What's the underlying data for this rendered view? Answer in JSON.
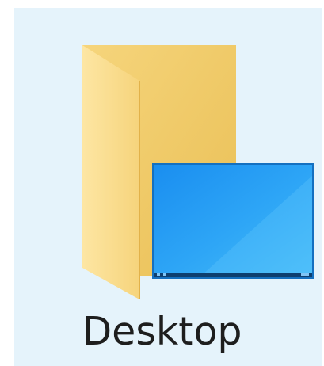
{
  "item": {
    "label": "Desktop",
    "icon": "desktop-folder-icon",
    "state": "hover"
  },
  "colors": {
    "hover_background": "#e5f3fb",
    "folder_back": "#f3cf6e",
    "folder_front": "#fbe29a",
    "screen": "#2aa4f4",
    "text": "#1e1e1e"
  }
}
